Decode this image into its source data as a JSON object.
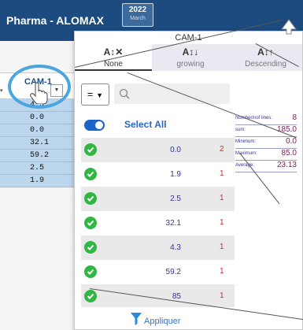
{
  "app": {
    "title": "Pharma - ALOMAX",
    "year": "2022",
    "month": "March"
  },
  "column": {
    "header": "CAM-1",
    "values": [
      "4.3",
      "0.0",
      "0.0",
      "32.1",
      "59.2",
      "2.5",
      "1.9"
    ]
  },
  "popup": {
    "title": "CAM-1",
    "sort": {
      "none_label": "None",
      "growing_label": "growing",
      "descending_label": "Descending"
    },
    "operator": "=",
    "search": {
      "placeholder": "",
      "value": ""
    },
    "select_all_label": "Select All",
    "items": [
      {
        "value": "0.0",
        "count": "2"
      },
      {
        "value": "1.9",
        "count": "1"
      },
      {
        "value": "2.5",
        "count": "1"
      },
      {
        "value": "32.1",
        "count": "1"
      },
      {
        "value": "4.3",
        "count": "1"
      },
      {
        "value": "59.2",
        "count": "1"
      },
      {
        "value": "85",
        "count": "1"
      }
    ],
    "stats": [
      {
        "label": "Number/nof lines:",
        "value": "8"
      },
      {
        "label": "sum:",
        "value": "185.0"
      },
      {
        "label": "Minimum:",
        "value": "0.0"
      },
      {
        "label": "Maximum:",
        "value": "85.0"
      },
      {
        "label": "Average:",
        "value": "23.13"
      }
    ],
    "apply_label": "Appliquer"
  },
  "colors": {
    "header_bg": "#1c4b7f",
    "cell_bg": "#bcd6ee",
    "check": "#2fb742",
    "toggle": "#1a63c7",
    "highlight": "#4ba6e0"
  }
}
